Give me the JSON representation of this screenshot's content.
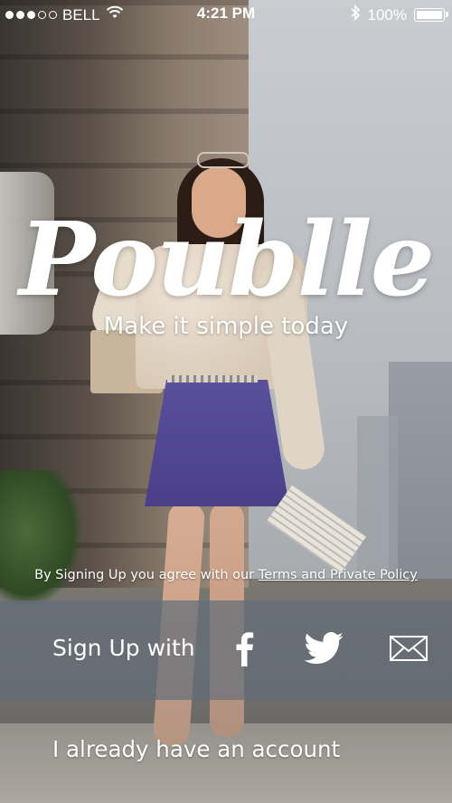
{
  "status_bar": {
    "carrier": "BELL",
    "time": "4:21 PM",
    "battery": "100%",
    "signal_bars_filled": 3,
    "signal_bars_total": 5
  },
  "brand": {
    "logo_text": "Poublle",
    "tagline": "Make it simple today"
  },
  "terms": {
    "prefix": "By Signing Up you agree with our",
    "link_text": "Terms and  Private Policy"
  },
  "signup": {
    "label": "Sign Up with",
    "options": [
      {
        "icon": "facebook-icon"
      },
      {
        "icon": "twitter-icon"
      },
      {
        "icon": "mail-icon"
      }
    ]
  },
  "login": {
    "label": "I already have an account"
  },
  "colors": {
    "band": "#626e7a",
    "text": "#ffffff"
  }
}
